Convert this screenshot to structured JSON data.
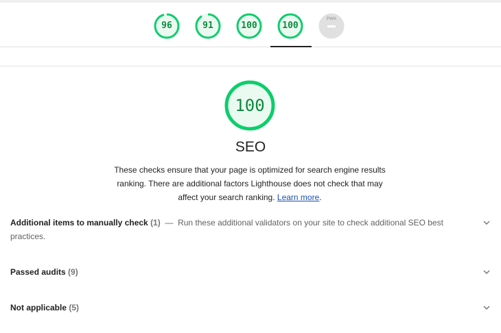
{
  "nav": {
    "gauges": [
      {
        "score": "96",
        "fraction": 0.96,
        "color": "#0cce6b"
      },
      {
        "score": "91",
        "fraction": 0.91,
        "color": "#0cce6b"
      },
      {
        "score": "100",
        "fraction": 1.0,
        "color": "#0cce6b"
      },
      {
        "score": "100",
        "fraction": 1.0,
        "color": "#0cce6b"
      }
    ],
    "pwa": {
      "label": "PWA",
      "color": "#e0e0e0"
    }
  },
  "category": {
    "score": "100",
    "score_fraction": 1.0,
    "title": "SEO",
    "description": "These checks ensure that your page is optimized for search engine results ranking. There are additional factors Lighthouse does not check that may affect your search ranking.",
    "learn_more": "Learn more"
  },
  "groups": [
    {
      "title": "Additional items to manually check",
      "count": "(1)",
      "separator": "—",
      "description": "Run these additional validators on your site to check additional SEO best practices."
    },
    {
      "title": "Passed audits",
      "count": "(9)"
    },
    {
      "title": "Not applicable",
      "count": "(5)"
    }
  ],
  "colors": {
    "pass": "#0cce6b",
    "pass_text": "#0c8a3c",
    "pass_bg": "#eafaf1"
  }
}
